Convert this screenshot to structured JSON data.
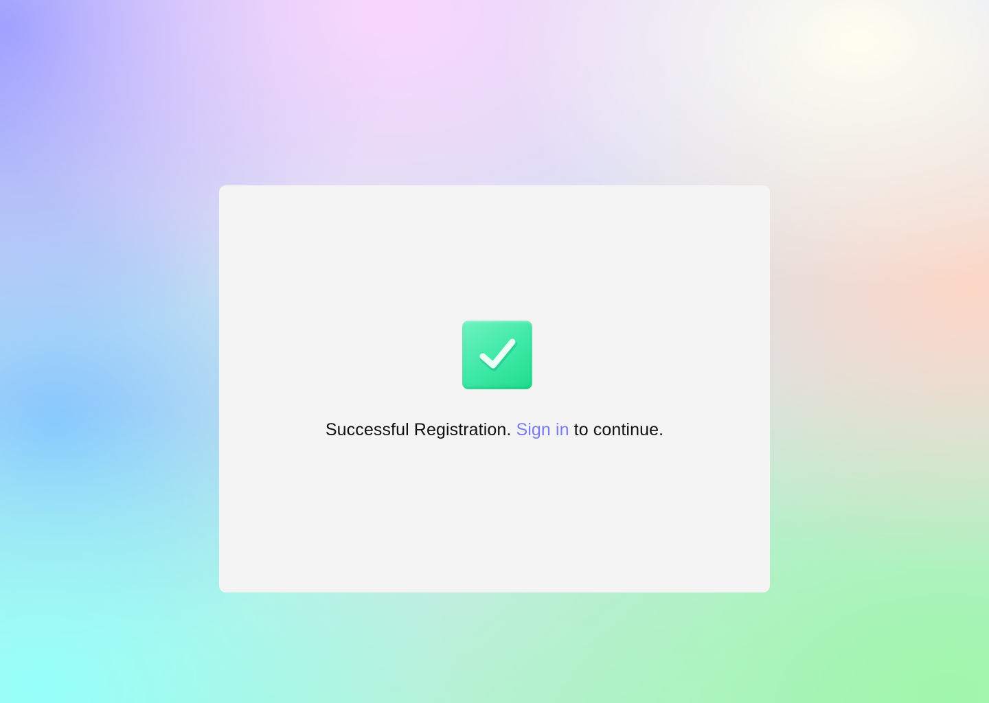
{
  "card": {
    "message_prefix": "Successful Registration.",
    "link_label": "Sign in",
    "message_suffix": "to continue."
  },
  "icons": {
    "status": "check-icon"
  },
  "colors": {
    "link": "#7b7bf0",
    "success_tile": "#3de8a6",
    "card_background": "#f4f4f4",
    "text": "#111111"
  }
}
